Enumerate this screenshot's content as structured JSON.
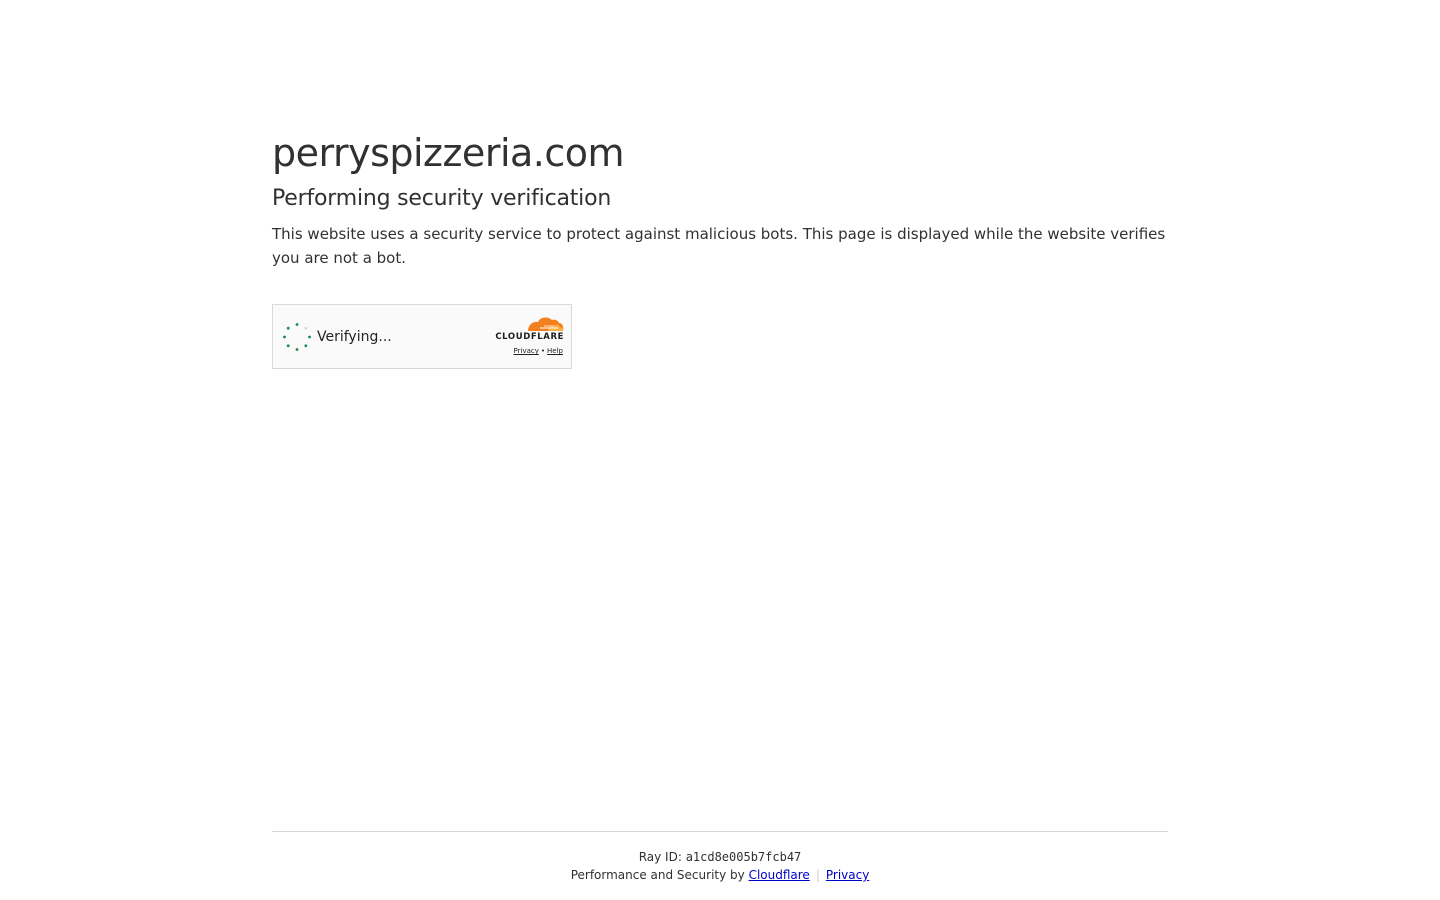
{
  "site": {
    "title": "perryspizzeria.com",
    "subtitle": "Performing security verification",
    "description": "This website uses a security service to protect against malicious bots. This page is displayed while the website verifies you are not a bot."
  },
  "widget": {
    "status_text": "Verifying...",
    "spinner_icon": "spinner-icon",
    "spinner_color": "#1a8a4a",
    "brand": "CLOUDFLARE",
    "brand_icon": "cloudflare-cloud-icon",
    "brand_color": "#f38020",
    "privacy_link": "Privacy",
    "link_separator": "•",
    "help_link": "Help"
  },
  "footer": {
    "ray_label": "Ray ID: ",
    "ray_id": "a1cd8e005b7fcb47",
    "performance_text": "Performance and Security by ",
    "cloudflare_link": "Cloudflare",
    "divider": "|",
    "privacy_link": "Privacy",
    "link_color": "#0000cc"
  }
}
